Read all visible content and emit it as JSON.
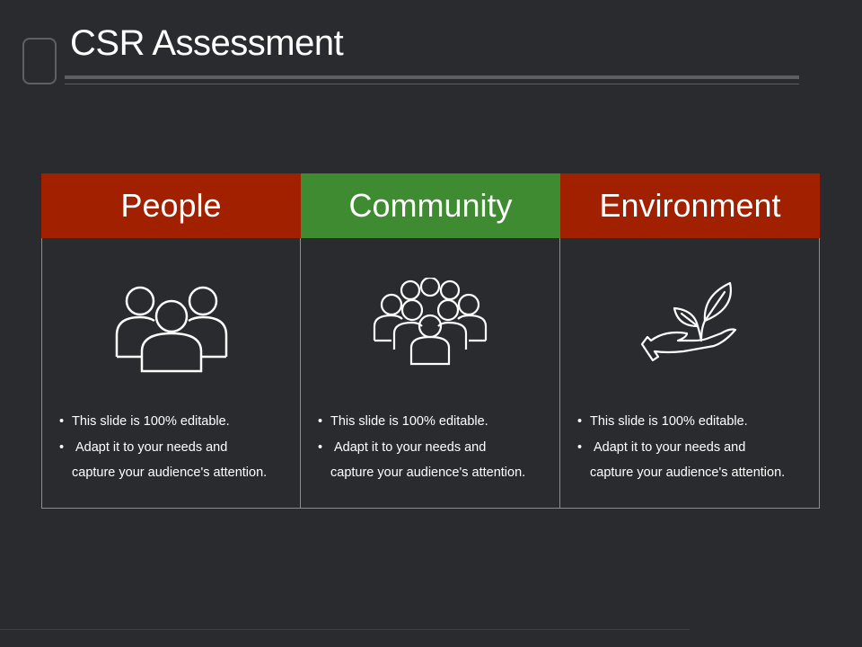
{
  "slide": {
    "title": "CSR Assessment"
  },
  "colors": {
    "background": "#2a2b2f",
    "header_red": "#a02000",
    "header_green": "#3f8b32",
    "border": "#8b8d91"
  },
  "panels": [
    {
      "heading": "People",
      "icon": "people-group-icon",
      "color": "#a02000",
      "bullet_1": "This slide is 100% editable.",
      "bullet_2_line_1": "Adapt it to your needs and",
      "bullet_2_line_2": "capture your audience's attention."
    },
    {
      "heading": "Community",
      "icon": "community-crowd-icon",
      "color": "#3f8b32",
      "bullet_1": "This slide is 100% editable.",
      "bullet_2_line_1": "Adapt it to your needs and",
      "bullet_2_line_2": "capture your audience's attention."
    },
    {
      "heading": "Environment",
      "icon": "hand-plant-icon",
      "color": "#a02000",
      "bullet_1": "This slide is 100% editable.",
      "bullet_2_line_1": "Adapt it to your needs and",
      "bullet_2_line_2": "capture your audience's attention."
    }
  ]
}
